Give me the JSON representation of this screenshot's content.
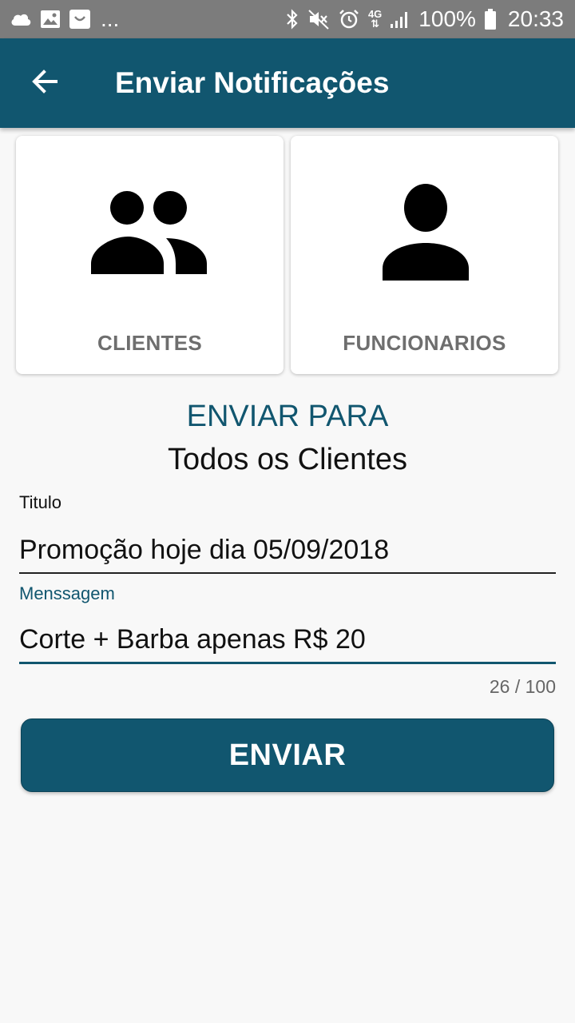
{
  "status_bar": {
    "left_icons": [
      "cloud-icon",
      "gallery-icon",
      "app-icon"
    ],
    "overflow": "...",
    "right_icons": [
      "bluetooth-icon",
      "mute-icon",
      "alarm-icon",
      "network-4g-icon",
      "signal-icon",
      "battery-icon"
    ],
    "network": "4G",
    "battery": "100%",
    "time": "20:33"
  },
  "app_bar": {
    "back_icon": "arrow-back-icon",
    "title": "Enviar Notificações"
  },
  "cards": [
    {
      "icon": "group-icon",
      "label": "CLIENTES"
    },
    {
      "icon": "person-icon",
      "label": "FUNCIONARIOS"
    }
  ],
  "send_to": {
    "label": "ENVIAR PARA",
    "value": "Todos os Clientes"
  },
  "form": {
    "title": {
      "label": "Titulo",
      "value": "Promoção hoje dia 05/09/2018"
    },
    "message": {
      "label": "Menssagem",
      "value": "Corte + Barba apenas R$ 20",
      "counter": "26 / 100"
    }
  },
  "submit_label": "ENVIAR",
  "colors": {
    "primary": "#11566f",
    "status_bar": "#7c7c7c",
    "background": "#f8f8f8",
    "card_label": "#6e6e6e"
  }
}
